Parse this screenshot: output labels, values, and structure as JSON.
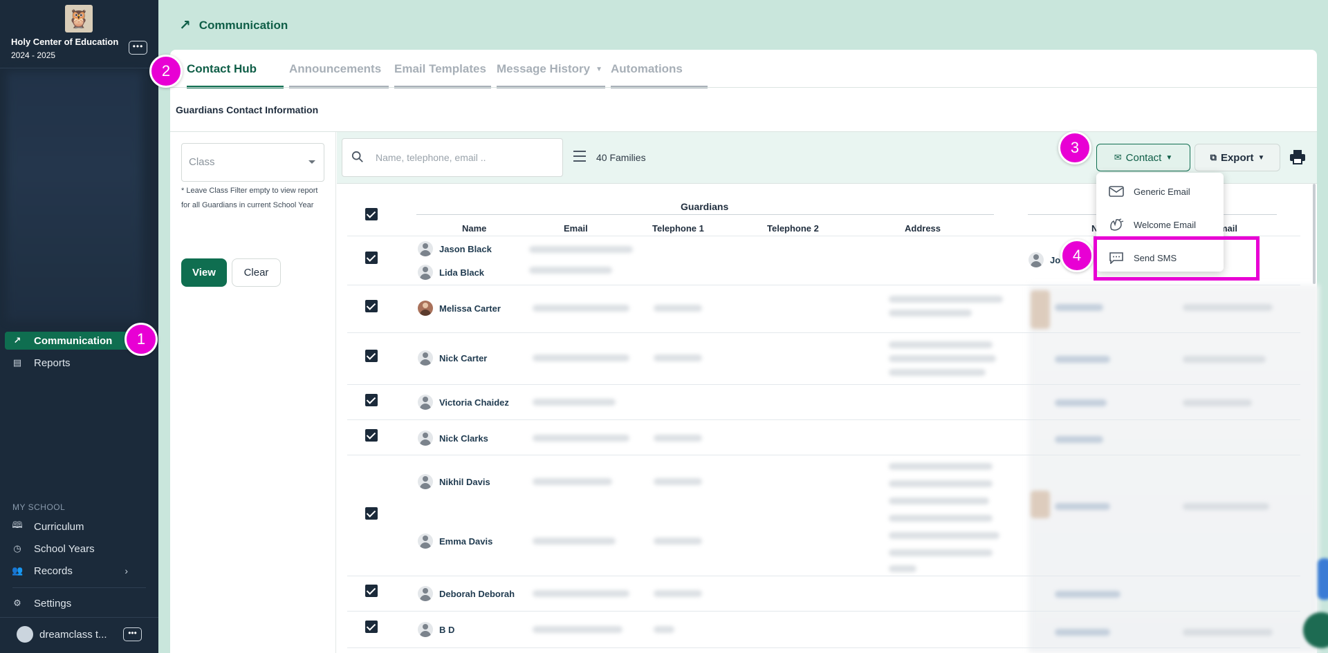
{
  "sidebar": {
    "school_name": "Holy Center of Education",
    "school_year": "2024 - 2025",
    "nav_main": [
      {
        "label": "Communication",
        "icon": "arrow-up-right-icon",
        "active": true
      },
      {
        "label": "Reports",
        "icon": "report-icon",
        "active": false
      }
    ],
    "section_label": "MY SCHOOL",
    "nav_school": [
      {
        "label": "Curriculum",
        "icon": "book-icon"
      },
      {
        "label": "School Years",
        "icon": "clock-icon"
      },
      {
        "label": "Records",
        "icon": "people-icon"
      }
    ],
    "settings_label": "Settings",
    "user_name": "dreamclass t..."
  },
  "header": {
    "title": "Communication"
  },
  "tabs": [
    {
      "label": "Contact Hub",
      "active": true
    },
    {
      "label": "Announcements"
    },
    {
      "label": "Email Templates"
    },
    {
      "label": "Message History"
    },
    {
      "label": "Automations"
    }
  ],
  "section_title": "Guardians Contact Information",
  "filter": {
    "class_placeholder": "Class",
    "note": "* Leave Class Filter empty to view report for all Guardians in current School Year",
    "view_label": "View",
    "clear_label": "Clear"
  },
  "toolbar": {
    "search_placeholder": "Name, telephone, email ..",
    "families_count": "40 Families",
    "contact_label": "Contact",
    "export_label": "Export"
  },
  "contact_menu": [
    {
      "label": "Generic Email",
      "icon": "email-icon"
    },
    {
      "label": "Welcome Email",
      "icon": "welcome-icon"
    },
    {
      "label": "Send SMS",
      "icon": "sms-icon"
    }
  ],
  "table": {
    "group_title": "Guardians",
    "columns": [
      "Name",
      "Email",
      "Telephone 1",
      "Telephone 2",
      "Address"
    ],
    "right_columns_partial": [
      "N",
      "mail"
    ],
    "partial_student_name": "Jo",
    "rows": [
      [
        "Jason Black",
        "Lida Black"
      ],
      [
        "Melissa Carter"
      ],
      [
        "Nick Carter"
      ],
      [
        "Victoria Chaidez"
      ],
      [
        "Nick Clarks"
      ],
      [
        "Nikhil Davis",
        "Emma Davis"
      ],
      [
        "Deborah Deborah"
      ],
      [
        "B D"
      ]
    ]
  },
  "badges": [
    "1",
    "2",
    "3",
    "4"
  ],
  "colors": {
    "accent": "#0f6e50",
    "sidebar": "#1b2a3a",
    "badge": "#e800d4"
  }
}
